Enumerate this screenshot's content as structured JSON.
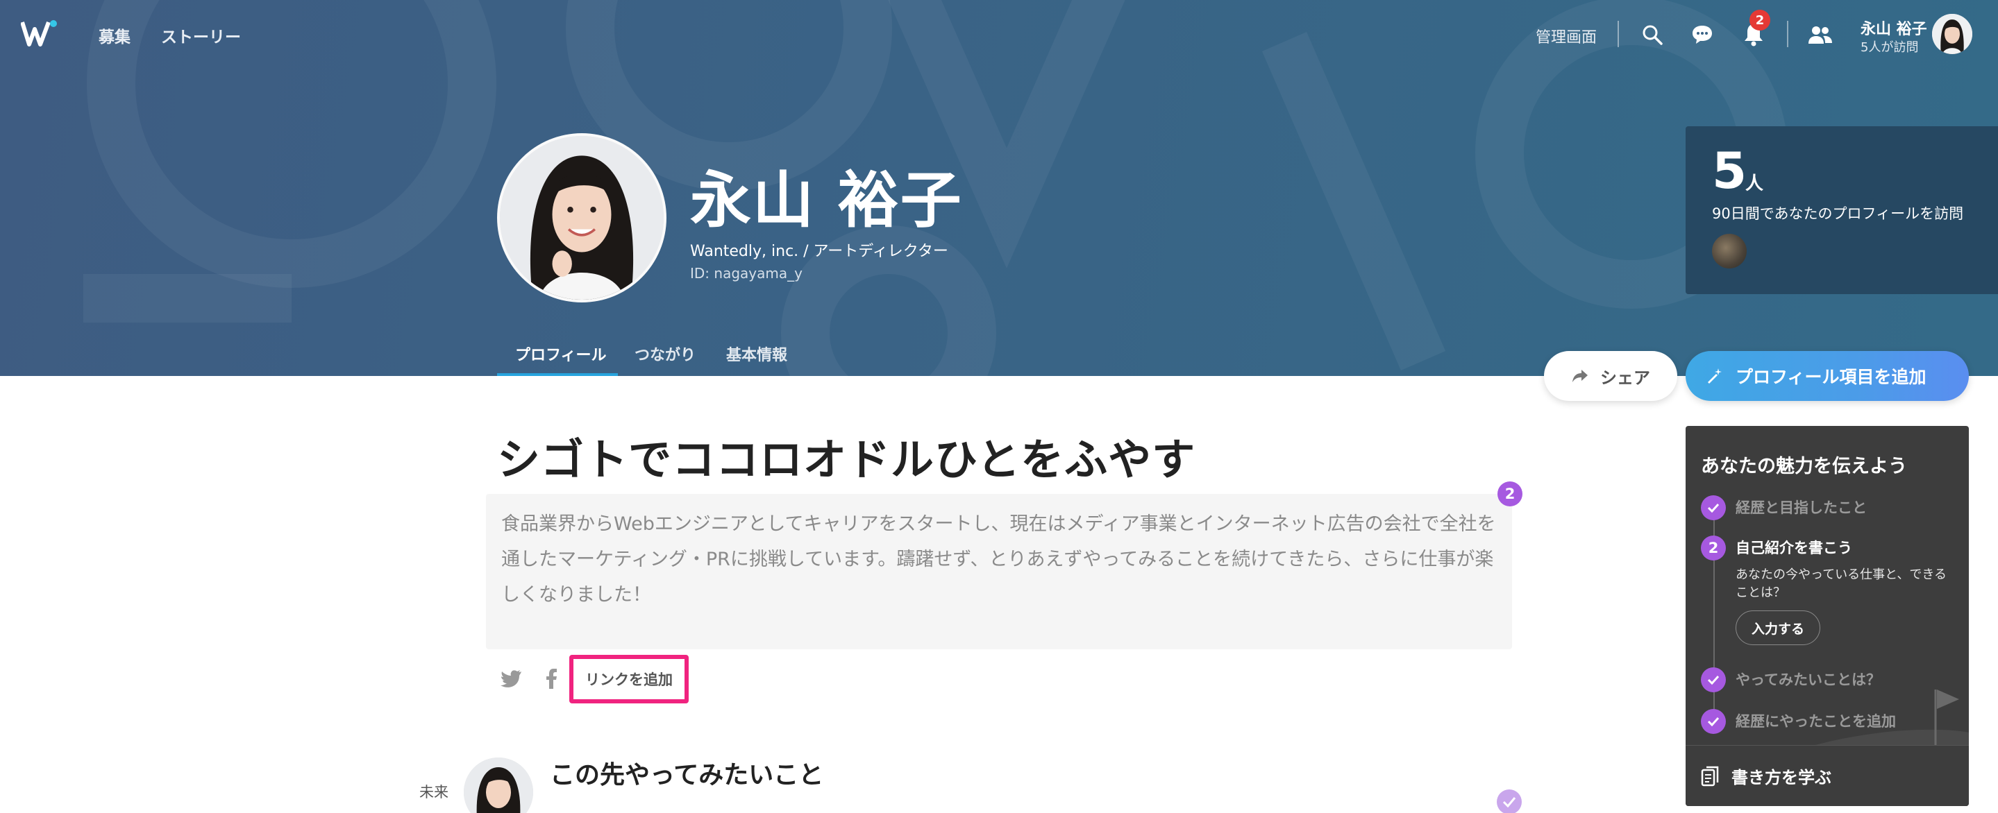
{
  "nav": {
    "logo": "wantedly-logo",
    "links": [
      "募集",
      "ストーリー"
    ],
    "admin": "管理画面",
    "notification_count": "2",
    "user_name": "永山 裕子",
    "user_visits": "5人が訪問"
  },
  "profile": {
    "name": "永山 裕子",
    "company_role": "Wantedly, inc. / アートディレクター",
    "id_text": "ID: nagayama_y",
    "tabs": [
      "プロフィール",
      "つながり",
      "基本情報"
    ],
    "active_tab": "プロフィール"
  },
  "visitors": {
    "count": "5",
    "unit": "人",
    "description": "90日間であなたのプロフィールを訪問"
  },
  "actions": {
    "share": "シェア",
    "add_item": "プロフィール項目を追加"
  },
  "main": {
    "title": "シゴトでココロオドルひとをふやす",
    "intro": "食品業界からWebエンジニアとしてキャリアをスタートし、現在はメディア事業とインターネット広告の会社で全社を通したマーケティング・PRに挑戦しています。躊躇せず、とりあえずやってみることを続けてきたら、さらに仕事が楽しくなりました！",
    "intro_step": "2",
    "add_link": "リンクを追加",
    "future_label": "未来",
    "future_title": "この先やってみたいこと"
  },
  "guide": {
    "title": "あなたの魅力を伝えよう",
    "steps": [
      {
        "label": "経歴と目指したこと",
        "state": "done"
      },
      {
        "label": "自己紹介を書こう",
        "state": "current",
        "number": "2"
      },
      {
        "label": "やってみたいことは？",
        "state": "done"
      },
      {
        "label": "経歴にやったことを追加",
        "state": "done"
      }
    ],
    "current_sub": "あなたの今やっている仕事と、できることは？",
    "input_button": "入力する",
    "footer": "書き方を学ぶ"
  },
  "colors": {
    "hero": "#3a6386",
    "accent_blue": "#3fa8e5",
    "purple": "#a659e0",
    "highlight_pink": "#f0237f",
    "panel_dark": "#3d3d3d"
  }
}
